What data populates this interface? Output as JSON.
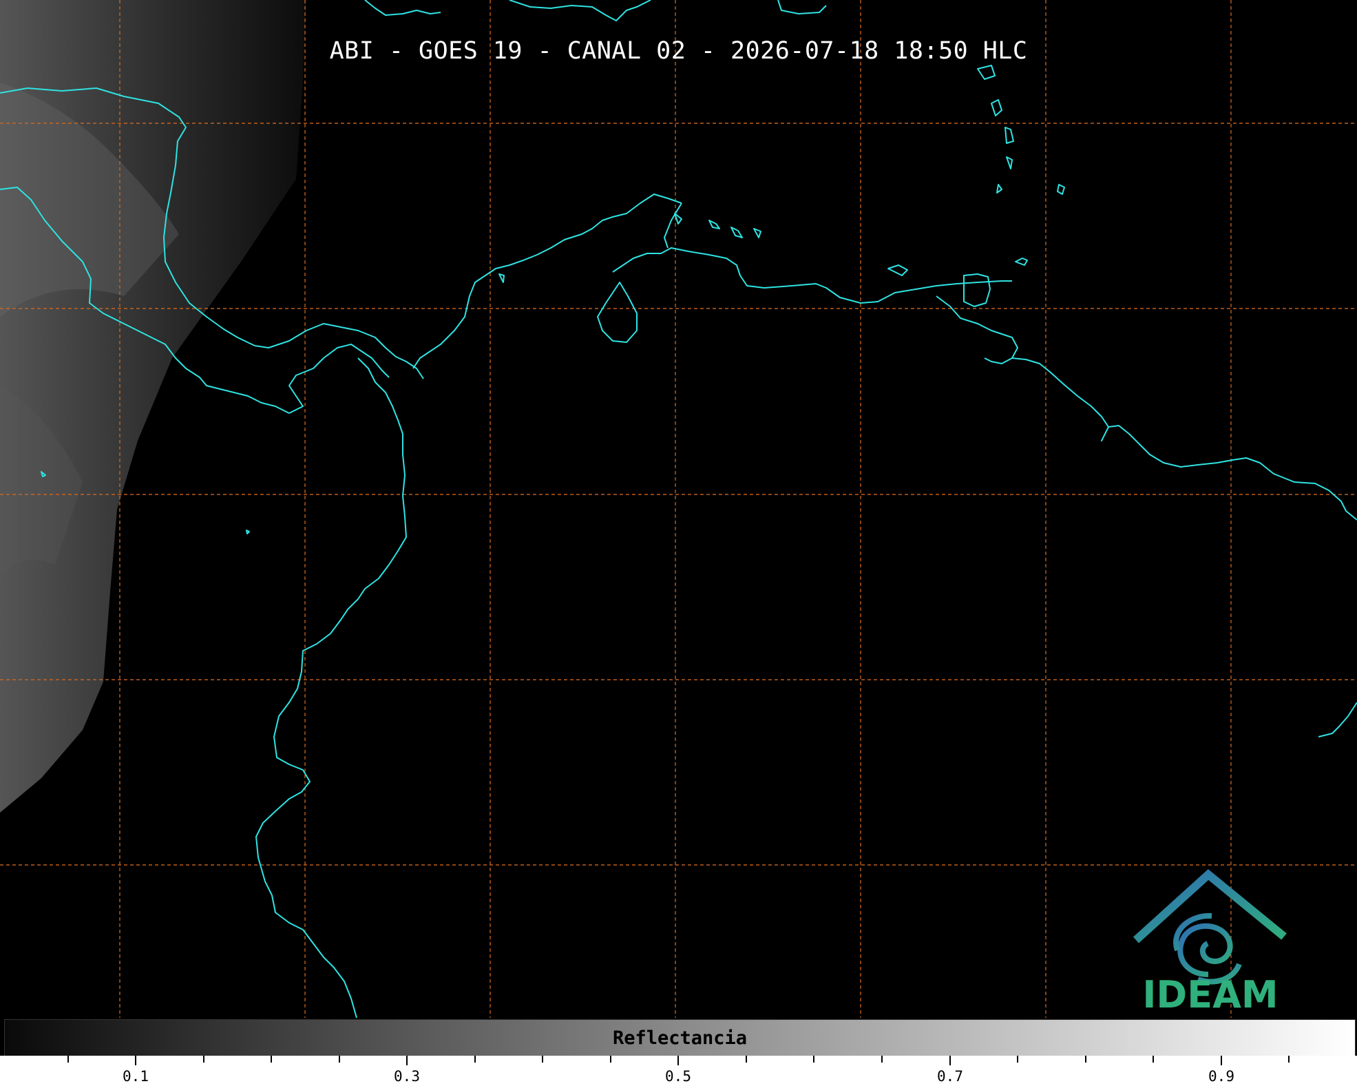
{
  "title": "ABI - GOES 19 - CANAL 02 - 2026-07-18 18:50 HLC",
  "colorbar": {
    "label": "Reflectancia",
    "ticks": [
      "0.1",
      "0.3",
      "0.5",
      "0.7",
      "0.9"
    ],
    "colors": [
      "#0a0a0a",
      "#ffffff"
    ]
  },
  "logo": {
    "text": "IDEAM",
    "colors": [
      "#2f6db6",
      "#2fb07c"
    ]
  },
  "map": {
    "coastline_color": "#2fe3e3",
    "grid_color": "#d2691e",
    "background": "#000000"
  }
}
